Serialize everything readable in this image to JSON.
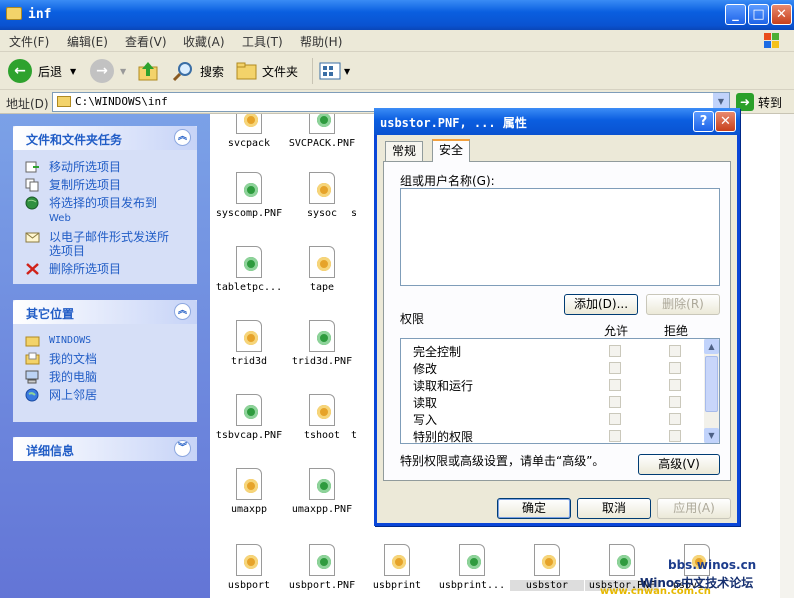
{
  "window": {
    "title": "inf"
  },
  "menu": [
    "文件(F)",
    "编辑(E)",
    "查看(V)",
    "收藏(A)",
    "工具(T)",
    "帮助(H)"
  ],
  "toolbar": {
    "back": "后退",
    "search": "搜索",
    "folders": "文件夹"
  },
  "address": {
    "label": "地址(D)",
    "value": "C:\\WINDOWS\\inf",
    "go": "转到"
  },
  "tasks_panel": {
    "title": "文件和文件夹任务",
    "items": [
      "移动所选项目",
      "复制所选项目",
      "将选择的项目发布到",
      "Web",
      "以电子邮件形式发送所",
      "选项目",
      "删除所选项目"
    ]
  },
  "places_panel": {
    "title": "其它位置",
    "items": [
      "WINDOWS",
      "我的文档",
      "我的电脑",
      "网上邻居"
    ]
  },
  "details_panel": {
    "title": "详细信息"
  },
  "files": [
    {
      "name": "svcpack"
    },
    {
      "name": "SVCPACK.PNF"
    },
    {
      "name": "syscomp.PNF"
    },
    {
      "name": "sysoc"
    },
    {
      "name": "s"
    },
    {
      "name": "tabletpc..."
    },
    {
      "name": "tape"
    },
    {
      "name": "trid3d"
    },
    {
      "name": "trid3d.PNF"
    },
    {
      "name": "tsbvcap.PNF"
    },
    {
      "name": "tshoot"
    },
    {
      "name": "t"
    },
    {
      "name": "umaxpp"
    },
    {
      "name": "umaxpp.PNF"
    },
    {
      "name": "usbport"
    },
    {
      "name": "usbport.PNF"
    },
    {
      "name": "usbprint"
    },
    {
      "name": "usbprint..."
    },
    {
      "name": "usbstor"
    },
    {
      "name": "usbstor.PNF"
    },
    {
      "name": "usbvi..."
    }
  ],
  "dialog": {
    "title": "usbstor.PNF, ... 属性",
    "tabs": [
      "常规",
      "安全"
    ],
    "group_label": "组或用户名称(G):",
    "add_button": "添加(D)...",
    "remove_button": "删除(R)",
    "perm_label": "权限",
    "allow_label": "允许",
    "deny_label": "拒绝",
    "permissions": [
      "完全控制",
      "修改",
      "读取和运行",
      "读取",
      "写入",
      "特别的权限"
    ],
    "advanced_hint": "特别权限或高级设置，请单击“高级”。",
    "advanced_button": "高级(V)",
    "ok_button": "确定",
    "cancel_button": "取消",
    "apply_button": "应用(A)"
  },
  "watermark": {
    "site": "bbs.winos.cn",
    "name": "Winos中文技术论坛",
    "url": "www.cnwan.com.cn"
  }
}
